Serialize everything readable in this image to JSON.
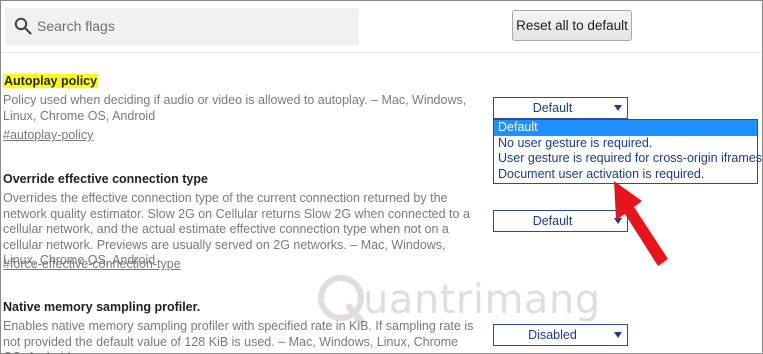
{
  "header": {
    "search_placeholder": "Search flags",
    "reset_label": "Reset all to default"
  },
  "flags": [
    {
      "title": "Autoplay policy",
      "description": "Policy used when deciding if audio or video is allowed to autoplay. – Mac, Windows, Linux, Chrome OS, Android",
      "link": "#autoplay-policy",
      "selected": "Default",
      "highlighted": true,
      "dropdown_open": true,
      "options": [
        "Default",
        "No user gesture is required.",
        "User gesture is required for cross-origin iframes.",
        "Document user activation is required."
      ]
    },
    {
      "title": "Override effective connection type",
      "description": "Overrides the effective connection type of the current connection returned by the network quality estimator. Slow 2G on Cellular returns Slow 2G when connected to a cellular network, and the actual estimate effective connection type when not on a cellular network. Previews are usually served on 2G networks. – Mac, Windows, Linux, Chrome OS, Android",
      "link": "#force-effective-connection-type",
      "selected": "Default"
    },
    {
      "title": "Native memory sampling profiler.",
      "description": "Enables native memory sampling profiler with specified rate in KiB. If sampling rate is not provided the default value of 128 KiB is used. – Mac, Windows, Linux, Chrome OS, Android",
      "selected": "Disabled"
    }
  ],
  "watermark": {
    "text": "uantrimang"
  },
  "colors": {
    "highlight": "#ffff00",
    "select_text": "#1a3c8c",
    "dropdown_selected_bg": "#1e90ff",
    "arrow": "#e8141b"
  }
}
